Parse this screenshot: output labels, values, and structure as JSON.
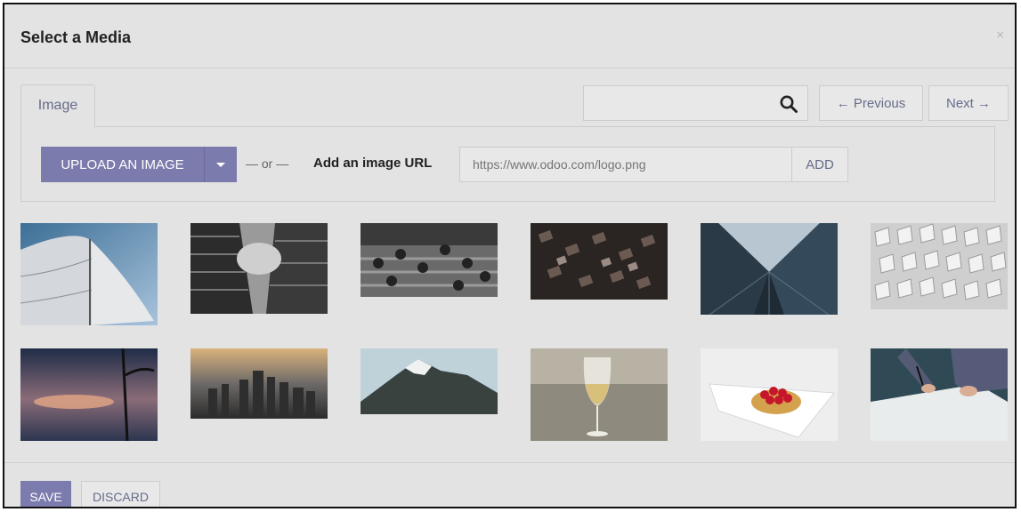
{
  "dialog": {
    "title": "Select a Media",
    "close_glyph": "×"
  },
  "tabs": [
    {
      "label": "Image",
      "active": true
    }
  ],
  "search": {
    "value": "",
    "placeholder": "",
    "icon": "search-icon"
  },
  "pager": {
    "previous_label": "← Previous",
    "next_label": "Next →"
  },
  "upload": {
    "upload_label": "UPLOAD AN IMAGE",
    "or_label": "— or —",
    "url_label": "Add an image URL",
    "url_placeholder": "https://www.odoo.com/logo.png",
    "add_label": "ADD"
  },
  "images": [
    {
      "subject": "sail"
    },
    {
      "subject": "skyscrapers-bw"
    },
    {
      "subject": "crowd-stairs"
    },
    {
      "subject": "letterpress-type"
    },
    {
      "subject": "glass-towers"
    },
    {
      "subject": "geometric-wall"
    },
    {
      "subject": "sunset-clouds"
    },
    {
      "subject": "city-skyline"
    },
    {
      "subject": "mountain"
    },
    {
      "subject": "wine-glass"
    },
    {
      "subject": "raspberry-tart"
    },
    {
      "subject": "signing-paper"
    }
  ],
  "footer": {
    "save_label": "SAVE",
    "discard_label": "DISCARD"
  },
  "colors": {
    "accent": "#7c7bad",
    "background": "#e3e3e3",
    "link": "#666c8a"
  }
}
